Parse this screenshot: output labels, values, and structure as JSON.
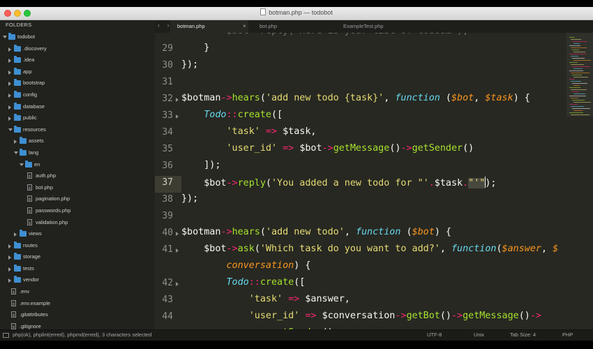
{
  "window": {
    "title": "botman.php — todobot"
  },
  "sidebar": {
    "header": "FOLDERS",
    "items": [
      {
        "label": "todobot",
        "kind": "folder",
        "depth": 0,
        "state": "open"
      },
      {
        "label": ".discovery",
        "kind": "folder",
        "depth": 1,
        "state": "closed"
      },
      {
        "label": ".idea",
        "kind": "folder",
        "depth": 1,
        "state": "closed"
      },
      {
        "label": "app",
        "kind": "folder",
        "depth": 1,
        "state": "closed"
      },
      {
        "label": "bootstrap",
        "kind": "folder",
        "depth": 1,
        "state": "closed"
      },
      {
        "label": "config",
        "kind": "folder",
        "depth": 1,
        "state": "closed"
      },
      {
        "label": "database",
        "kind": "folder",
        "depth": 1,
        "state": "closed"
      },
      {
        "label": "public",
        "kind": "folder",
        "depth": 1,
        "state": "closed"
      },
      {
        "label": "resources",
        "kind": "folder",
        "depth": 1,
        "state": "open"
      },
      {
        "label": "assets",
        "kind": "folder",
        "depth": 2,
        "state": "closed"
      },
      {
        "label": "lang",
        "kind": "folder",
        "depth": 2,
        "state": "open"
      },
      {
        "label": "en",
        "kind": "folder",
        "depth": 3,
        "state": "open"
      },
      {
        "label": "auth.php",
        "kind": "file",
        "depth": 4
      },
      {
        "label": "bot.php",
        "kind": "file",
        "depth": 4
      },
      {
        "label": "pagination.php",
        "kind": "file",
        "depth": 4
      },
      {
        "label": "passwords.php",
        "kind": "file",
        "depth": 4
      },
      {
        "label": "validation.php",
        "kind": "file",
        "depth": 4
      },
      {
        "label": "views",
        "kind": "folder",
        "depth": 2,
        "state": "closed"
      },
      {
        "label": "routes",
        "kind": "folder",
        "depth": 1,
        "state": "closed"
      },
      {
        "label": "storage",
        "kind": "folder",
        "depth": 1,
        "state": "closed"
      },
      {
        "label": "tests",
        "kind": "folder",
        "depth": 1,
        "state": "closed"
      },
      {
        "label": "vendor",
        "kind": "folder",
        "depth": 1,
        "state": "closed"
      },
      {
        "label": ".env",
        "kind": "file",
        "depth": 1
      },
      {
        "label": ".env.example",
        "kind": "file",
        "depth": 1
      },
      {
        "label": ".gitattributes",
        "kind": "file",
        "depth": 1
      },
      {
        "label": ".gitignore",
        "kind": "file",
        "depth": 1
      }
    ]
  },
  "tabs": [
    {
      "label": "botman.php",
      "active": true,
      "close": "×"
    },
    {
      "label": "bot.php",
      "active": false
    },
    {
      "label": "ExampleTest.php",
      "active": false
    }
  ],
  "nav_arrows": "‹ ›",
  "editor": {
    "current_line": "37",
    "lines": [
      {
        "n": "",
        "tokens": [
          {
            "t": "        $bot->reply('Here is your list of todos…');",
            "c": "dim"
          }
        ]
      },
      {
        "n": "29",
        "tokens": [
          {
            "t": "    }",
            "c": ""
          }
        ]
      },
      {
        "n": "30",
        "tokens": [
          {
            "t": "});",
            "c": ""
          }
        ]
      },
      {
        "n": "31",
        "tokens": []
      },
      {
        "n": "32",
        "fold": true,
        "tokens": [
          {
            "t": "$botman",
            "c": ""
          },
          {
            "t": "->",
            "c": "kw"
          },
          {
            "t": "hears",
            "c": "fn"
          },
          {
            "t": "(",
            "c": ""
          },
          {
            "t": "'add new todo {task}'",
            "c": "st"
          },
          {
            "t": ", ",
            "c": ""
          },
          {
            "t": "function",
            "c": "it"
          },
          {
            "t": " (",
            "c": ""
          },
          {
            "t": "$bot",
            "c": "pa"
          },
          {
            "t": ", ",
            "c": ""
          },
          {
            "t": "$task",
            "c": "pa"
          },
          {
            "t": ") {",
            "c": ""
          }
        ]
      },
      {
        "n": "33",
        "fold": true,
        "tokens": [
          {
            "t": "    ",
            "c": ""
          },
          {
            "t": "Todo",
            "c": "it"
          },
          {
            "t": "::",
            "c": "kw"
          },
          {
            "t": "create",
            "c": "fn"
          },
          {
            "t": "([",
            "c": ""
          }
        ]
      },
      {
        "n": "34",
        "tokens": [
          {
            "t": "        ",
            "c": ""
          },
          {
            "t": "'task'",
            "c": "st"
          },
          {
            "t": " => ",
            "c": "kw"
          },
          {
            "t": "$task,",
            "c": ""
          }
        ]
      },
      {
        "n": "35",
        "tokens": [
          {
            "t": "        ",
            "c": ""
          },
          {
            "t": "'user_id'",
            "c": "st"
          },
          {
            "t": " => ",
            "c": "kw"
          },
          {
            "t": "$bot",
            "c": ""
          },
          {
            "t": "->",
            "c": "kw"
          },
          {
            "t": "getMessage",
            "c": "fn"
          },
          {
            "t": "()",
            "c": ""
          },
          {
            "t": "->",
            "c": "kw"
          },
          {
            "t": "getSender",
            "c": "fn"
          },
          {
            "t": "()",
            "c": ""
          }
        ]
      },
      {
        "n": "36",
        "tokens": [
          {
            "t": "    ]);",
            "c": ""
          }
        ]
      },
      {
        "n": "37",
        "tokens": [
          {
            "t": "    $bot",
            "c": ""
          },
          {
            "t": "->",
            "c": "kw"
          },
          {
            "t": "reply",
            "c": "fn"
          },
          {
            "t": "(",
            "c": ""
          },
          {
            "t": "'You added a new todo for \"'",
            "c": "st"
          },
          {
            "t": ".",
            "c": "kw"
          },
          {
            "t": "$task",
            "c": ""
          },
          {
            "t": ".",
            "c": "kw"
          },
          {
            "t": "\"'\"",
            "c": "st sel"
          },
          {
            "t": "|",
            "c": "cursor"
          },
          {
            "t": ");",
            "c": ""
          }
        ]
      },
      {
        "n": "38",
        "tokens": [
          {
            "t": "});",
            "c": ""
          }
        ]
      },
      {
        "n": "39",
        "tokens": []
      },
      {
        "n": "40",
        "fold": true,
        "tokens": [
          {
            "t": "$botman",
            "c": ""
          },
          {
            "t": "->",
            "c": "kw"
          },
          {
            "t": "hears",
            "c": "fn"
          },
          {
            "t": "(",
            "c": ""
          },
          {
            "t": "'add new todo'",
            "c": "st"
          },
          {
            "t": ", ",
            "c": ""
          },
          {
            "t": "function",
            "c": "it"
          },
          {
            "t": " (",
            "c": ""
          },
          {
            "t": "$bot",
            "c": "pa"
          },
          {
            "t": ") {",
            "c": ""
          }
        ]
      },
      {
        "n": "41",
        "fold": true,
        "tokens": [
          {
            "t": "    $bot",
            "c": ""
          },
          {
            "t": "->",
            "c": "kw"
          },
          {
            "t": "ask",
            "c": "fn"
          },
          {
            "t": "(",
            "c": ""
          },
          {
            "t": "'Which task do you want to add?'",
            "c": "st"
          },
          {
            "t": ", ",
            "c": ""
          },
          {
            "t": "function",
            "c": "it"
          },
          {
            "t": "(",
            "c": ""
          },
          {
            "t": "$answer",
            "c": "pa"
          },
          {
            "t": ", ",
            "c": ""
          },
          {
            "t": "$",
            "c": "pa"
          }
        ]
      },
      {
        "n": "",
        "tokens": [
          {
            "t": "        ",
            "c": ""
          },
          {
            "t": "conversation",
            "c": "pa"
          },
          {
            "t": ") {",
            "c": ""
          }
        ]
      },
      {
        "n": "42",
        "fold": true,
        "tokens": [
          {
            "t": "        ",
            "c": ""
          },
          {
            "t": "Todo",
            "c": "it"
          },
          {
            "t": "::",
            "c": "kw"
          },
          {
            "t": "create",
            "c": "fn"
          },
          {
            "t": "([",
            "c": ""
          }
        ]
      },
      {
        "n": "43",
        "tokens": [
          {
            "t": "            ",
            "c": ""
          },
          {
            "t": "'task'",
            "c": "st"
          },
          {
            "t": " => ",
            "c": "kw"
          },
          {
            "t": "$answer,",
            "c": ""
          }
        ]
      },
      {
        "n": "44",
        "tokens": [
          {
            "t": "            ",
            "c": ""
          },
          {
            "t": "'user_id'",
            "c": "st"
          },
          {
            "t": " => ",
            "c": "kw"
          },
          {
            "t": "$conversation",
            "c": ""
          },
          {
            "t": "->",
            "c": "kw"
          },
          {
            "t": "getBot",
            "c": "fn"
          },
          {
            "t": "()",
            "c": ""
          },
          {
            "t": "->",
            "c": "kw"
          },
          {
            "t": "getMessage",
            "c": "fn"
          },
          {
            "t": "()",
            "c": ""
          },
          {
            "t": "->",
            "c": "kw"
          }
        ]
      },
      {
        "n": "",
        "tokens": [
          {
            "t": "                ",
            "c": ""
          },
          {
            "t": "getSender",
            "c": "fn"
          },
          {
            "t": "()",
            "c": ""
          }
        ]
      }
    ]
  },
  "status": {
    "left": "php(ok), phplint(erred), phpmd(erred), 3 characters selected",
    "encoding": "UTF-8",
    "line_endings": "Unix",
    "tab_size": "Tab Size: 4",
    "syntax": "PHP"
  },
  "colors": {
    "background": "#272822",
    "keyword": "#f92672",
    "function": "#a6e22e",
    "string": "#e6db74",
    "storage": "#66d9ef",
    "parameter": "#fd971f",
    "folder": "#3f8fd2"
  }
}
